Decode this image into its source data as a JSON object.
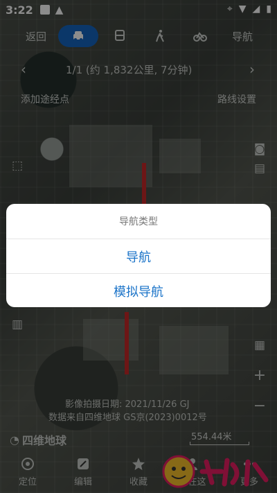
{
  "status_bar": {
    "time": "3:22"
  },
  "tabs": {
    "back": "返回",
    "navigate": "导航"
  },
  "route": {
    "summary": "1/1  (约 1,832公里, 7分钟)"
  },
  "map": {
    "add_waypoint": "添加途经点",
    "route_settings": "路线设置",
    "image_date": "影像拍摄日期: 2021/11/26 GJ",
    "data_source": "数据来自四维地球 GS京(2023)0012号",
    "logo_text": "四维地球",
    "scale": "554.44米"
  },
  "dialog": {
    "title": "导航类型",
    "option_navigate": "导航",
    "option_simulate": "模拟导航"
  },
  "bottom_nav": {
    "locate": "定位",
    "edit": "编辑",
    "favorite": "收藏",
    "here": "我在这",
    "more": "更多"
  },
  "colors": {
    "accent": "#1a73c8",
    "tab_active": "#1565c0"
  }
}
